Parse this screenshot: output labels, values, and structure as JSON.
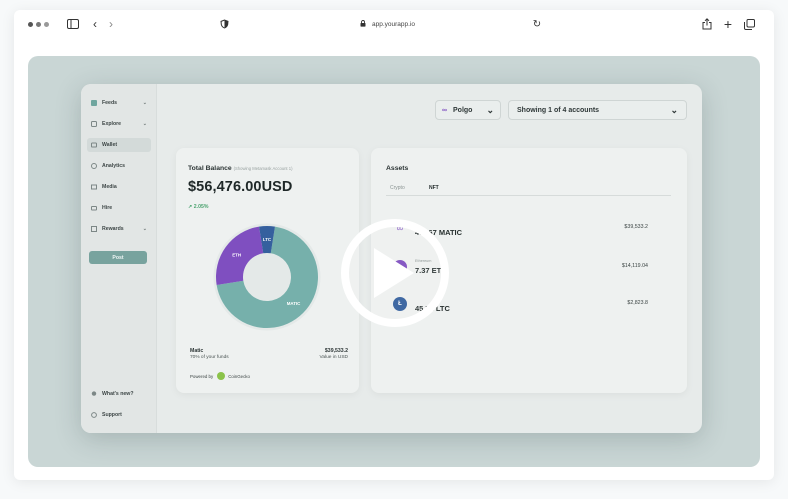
{
  "browser": {
    "url": "app.yourapp.io"
  },
  "sidebar": {
    "items": [
      {
        "label": "Feeds",
        "icon": "feeds-icon",
        "has_chevron": true
      },
      {
        "label": "Explore",
        "icon": "explore-icon",
        "has_chevron": true
      },
      {
        "label": "Wallet",
        "icon": "wallet-icon",
        "active": true
      },
      {
        "label": "Analytics",
        "icon": "analytics-icon"
      },
      {
        "label": "Media",
        "icon": "media-icon"
      },
      {
        "label": "Hire",
        "icon": "hire-icon"
      },
      {
        "label": "Rewards",
        "icon": "rewards-icon",
        "has_chevron": true
      }
    ],
    "post_button": "Post",
    "bottom_items": [
      {
        "label": "What's new?",
        "icon": "bulb-icon"
      },
      {
        "label": "Support",
        "icon": "support-icon"
      }
    ]
  },
  "header": {
    "network_select": "Polgo",
    "accounts_select": "Showing 1 of 4 accounts"
  },
  "balance_card": {
    "title": "Total Balance",
    "subtitle": "(Showing Metamask Account 1)",
    "amount": "$56,476.00USD",
    "change": "↗ 2.05%",
    "donut": [
      {
        "label": "MATIC",
        "value": 39533.2,
        "color": "#76b0ab"
      },
      {
        "label": "ETH",
        "value": 14119.04,
        "color": "#7f4fc0"
      },
      {
        "label": "LTC",
        "value": 2823.8,
        "color": "#35609e"
      }
    ],
    "selected_name": "Matic",
    "selected_share": "70% of your funds",
    "selected_value": "$39,533.2",
    "selected_value_caption": "Value in USD",
    "powered_by": "Powered by",
    "powered_by_brand": "CoinGecko"
  },
  "assets_card": {
    "title": "Assets",
    "tabs": [
      "Crypto",
      "NFT"
    ],
    "active_tab": 0,
    "rows": [
      {
        "icon": "polygon-icon",
        "caption": "",
        "amount": "40  .67 MATIC",
        "usd": "$39,533.2",
        "color": "#7f4fc0"
      },
      {
        "icon": "ethereum-icon",
        "caption": "Ethereum",
        "amount": "7.37 ET",
        "usd": "$14,119.04",
        "color": "#7f4fc0"
      },
      {
        "icon": "litecoin-icon",
        "caption": "",
        "amount": "45.71 LTC",
        "usd": "$2,823.8",
        "color": "#35609e"
      }
    ]
  },
  "overlay": {
    "play_icon": "play-icon"
  }
}
